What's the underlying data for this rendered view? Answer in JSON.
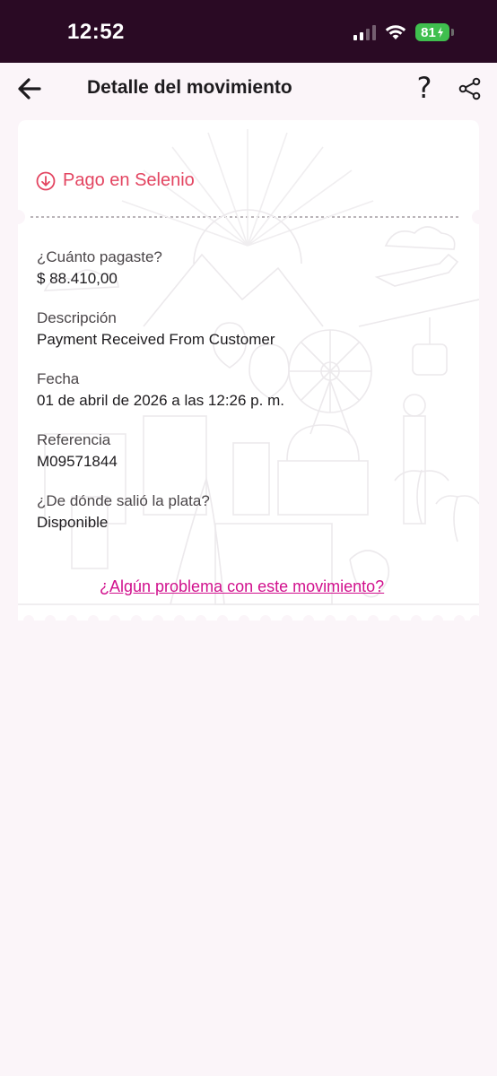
{
  "status_bar": {
    "time": "12:52",
    "battery": "81"
  },
  "header": {
    "title": "Detalle del movimiento",
    "help_glyph": "?"
  },
  "movement": {
    "type_label": "Pago en Selenio",
    "fields": [
      {
        "label": "¿Cuánto pagaste?",
        "value": "$ 88.410,00"
      },
      {
        "label": "Descripción",
        "value": "Payment Received From Customer"
      },
      {
        "label": "Fecha",
        "value": "01 de abril de 2026 a las 12:26 p. m."
      },
      {
        "label": "Referencia",
        "value": "M09571844"
      },
      {
        "label": "¿De dónde salió la plata?",
        "value": "Disponible"
      }
    ],
    "problem_link": "¿Algún problema con este movimiento?"
  },
  "colors": {
    "status_bar_bg": "#2a0a24",
    "page_bg": "#fbf5f9",
    "accent_red": "#e34561",
    "link_magenta": "#d1108d",
    "battery_green": "#3fbf4e"
  },
  "icons": [
    "signal-icon",
    "wifi-icon",
    "battery-icon",
    "back-arrow-icon",
    "help-icon",
    "share-icon",
    "arrow-down-circle-icon"
  ]
}
